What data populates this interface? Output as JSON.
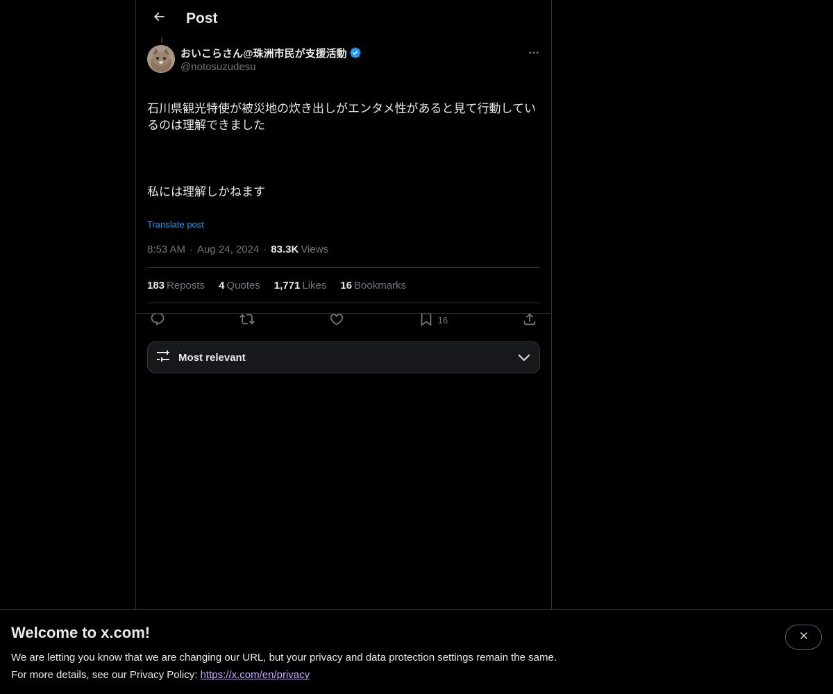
{
  "header": {
    "title": "Post",
    "back_icon": "arrow-left-icon"
  },
  "post": {
    "author": {
      "display_name": "おいこらさん@珠洲市民が支援活動",
      "handle": "@notosuzudesu",
      "verified": true,
      "verified_color": "#1d9bf0"
    },
    "text_line1": "石川県観光特使が被災地の炊き出しがエンタメ性があると見て行動しているのは理解できました",
    "text_line2": "私には理解しかねます",
    "translate_label": "Translate post",
    "time": "8:53 AM",
    "date": "Aug 24, 2024",
    "views_count": "83.3K",
    "views_label": "Views",
    "stats": {
      "reposts_count": "183",
      "reposts_label": "Reposts",
      "quotes_count": "4",
      "quotes_label": "Quotes",
      "likes_count": "1,771",
      "likes_label": "Likes",
      "bookmarks_count": "16",
      "bookmarks_label": "Bookmarks"
    },
    "actions": {
      "reply_icon": "reply-icon",
      "repost_icon": "repost-icon",
      "like_icon": "heart-icon",
      "bookmark_icon": "bookmark-icon",
      "bookmark_count": "16",
      "share_icon": "share-icon"
    }
  },
  "sort": {
    "label": "Most relevant",
    "icon": "sliders-icon",
    "chevron": "chevron-down-icon"
  },
  "banner": {
    "title": "Welcome to x.com!",
    "line1": "We are letting you know that we are changing our URL, but your privacy and data protection settings remain the same.",
    "line2_prefix": "For more details, see our Privacy Policy: ",
    "link": "https://x.com/en/privacy",
    "close_icon": "close-icon"
  },
  "colors": {
    "background": "#000000",
    "text": "#e7e9ea",
    "muted": "#71767b",
    "accent": "#1d9bf0",
    "border": "#2f3336"
  }
}
